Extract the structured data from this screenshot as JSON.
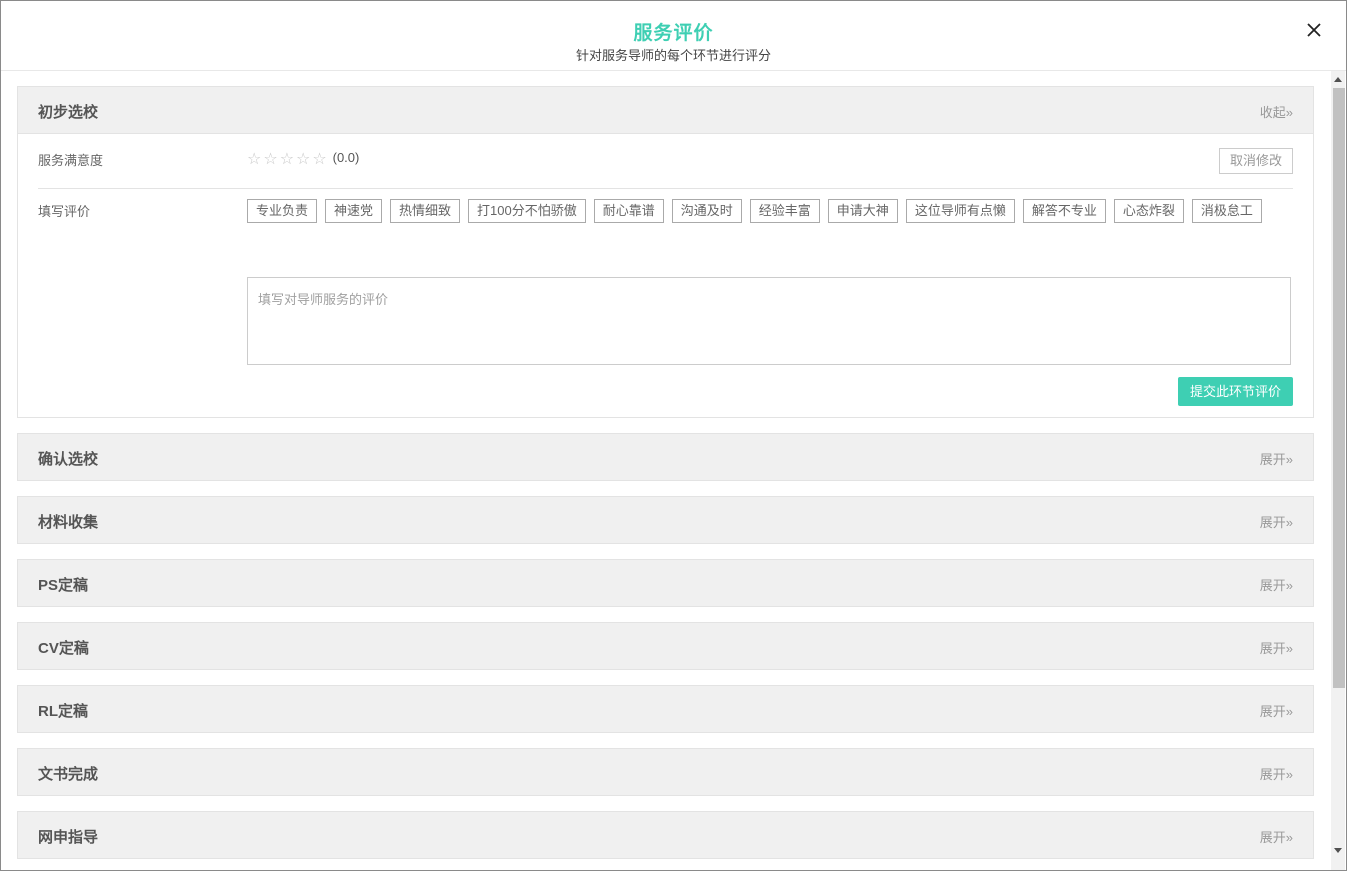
{
  "header": {
    "title": "服务评价",
    "subtitle": "针对服务导师的每个环节进行评分",
    "close_icon": "close-icon"
  },
  "colors": {
    "accent": "#3ecfb3",
    "section_bg": "#f0f0f0"
  },
  "expanded_section": {
    "name": "初步选校",
    "toggle": "收起»",
    "satisfaction_label": "服务满意度",
    "rating": "(0.0)",
    "stars_total": 5,
    "stars_filled": 0,
    "cancel_label": "取消修改",
    "review_label": "填写评价",
    "tags": [
      "专业负责",
      "神速党",
      "热情细致",
      "打100分不怕骄傲",
      "耐心靠谱",
      "沟通及时",
      "经验丰富",
      "申请大神",
      "这位导师有点懒",
      "解答不专业",
      "心态炸裂",
      "消极怠工"
    ],
    "comment_placeholder": "填写对导师服务的评价",
    "submit_label": "提交此环节评价"
  },
  "sections": [
    {
      "name": "确认选校",
      "toggle": "展开»"
    },
    {
      "name": "材料收集",
      "toggle": "展开»"
    },
    {
      "name": "PS定稿",
      "toggle": "展开»"
    },
    {
      "name": "CV定稿",
      "toggle": "展开»"
    },
    {
      "name": "RL定稿",
      "toggle": "展开»"
    },
    {
      "name": "文书完成",
      "toggle": "展开»"
    },
    {
      "name": "网申指导",
      "toggle": "展开»"
    }
  ]
}
